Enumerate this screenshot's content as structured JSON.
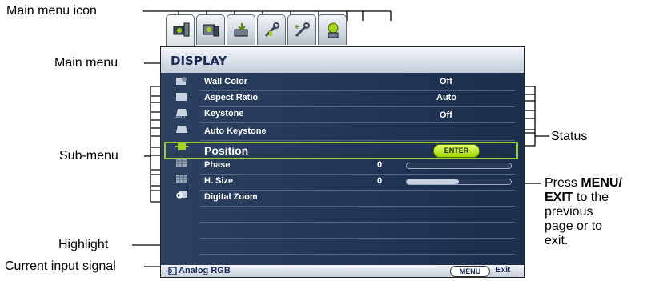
{
  "callouts": {
    "main_menu_icon": "Main menu icon",
    "main_menu": "Main menu",
    "sub_menu": "Sub-menu",
    "highlight": "Highlight",
    "current_input_signal": "Current input signal",
    "status": "Status",
    "press_pre": "Press ",
    "press_bold": "MENU/",
    "exit_bold": "EXIT",
    "exit_rest": " to the",
    "line3": "previous",
    "line4": "page or to",
    "line5": "exit."
  },
  "tabs": [
    {
      "icon": "display-icon",
      "active": true
    },
    {
      "icon": "picture-icon",
      "active": false
    },
    {
      "icon": "source-icon",
      "active": false
    },
    {
      "icon": "system-setup-basic-icon",
      "active": false
    },
    {
      "icon": "system-setup-advanced-icon",
      "active": false
    },
    {
      "icon": "information-icon",
      "active": false
    }
  ],
  "osd": {
    "title": "DISPLAY",
    "rows": [
      {
        "label": "Wall Color",
        "value": "Off",
        "icon": "wall-color-icon"
      },
      {
        "label": "Aspect Ratio",
        "value": "Auto",
        "icon": "aspect-ratio-icon"
      },
      {
        "label": "Keystone",
        "value": "Off",
        "icon": "keystone-icon"
      },
      {
        "label": "Auto Keystone",
        "value": "",
        "icon": "auto-keystone-icon"
      },
      {
        "label": "Position",
        "value": "",
        "icon": "position-icon",
        "button": "ENTER"
      },
      {
        "label": "Phase",
        "value": "0",
        "icon": "phase-icon",
        "slider": 0.0
      },
      {
        "label": "H. Size",
        "value": "0",
        "icon": "h-size-icon",
        "slider": 0.5
      },
      {
        "label": "Digital Zoom",
        "value": "",
        "icon": "digital-zoom-icon"
      }
    ],
    "footer": {
      "input_signal": "Analog RGB",
      "menu_button": "MENU",
      "exit_label": "Exit"
    }
  },
  "colors": {
    "panel": "#1e2c44",
    "highlight_border": "#9acd32",
    "enter_button": "#c0f000",
    "header_text": "#1a2a55"
  }
}
